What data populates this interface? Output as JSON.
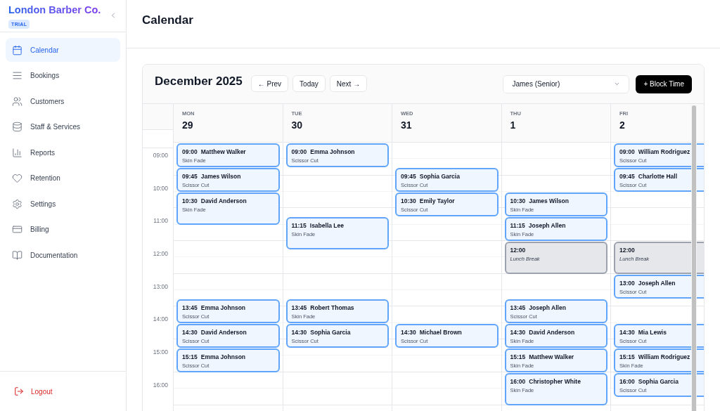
{
  "brand": {
    "name": "London Barber Co.",
    "badge": "TRIAL"
  },
  "sidebar": {
    "items": [
      {
        "label": "Calendar",
        "selected": true
      },
      {
        "label": "Bookings",
        "selected": false
      },
      {
        "label": "Customers",
        "selected": false
      },
      {
        "label": "Staff & Services",
        "selected": false
      },
      {
        "label": "Reports",
        "selected": false
      },
      {
        "label": "Retention",
        "selected": false
      },
      {
        "label": "Settings",
        "selected": false
      },
      {
        "label": "Billing",
        "selected": false
      },
      {
        "label": "Documentation",
        "selected": false
      }
    ],
    "logout": "Logout"
  },
  "page": {
    "title": "Calendar"
  },
  "calendar": {
    "month": "December 2025",
    "prev": "← Prev",
    "today": "Today",
    "next": "Next →",
    "staff_select": "James (Senior)",
    "block_button": "+ Block Time",
    "hours": [
      "09:00",
      "10:00",
      "11:00",
      "12:00",
      "13:00",
      "14:00",
      "15:00",
      "16:00"
    ],
    "days": [
      {
        "weekday": "MON",
        "date": "29",
        "events": [
          {
            "kind": "appointment",
            "time": "09:00",
            "name": "Matthew Walker",
            "service": "Skin Fade",
            "long": false
          },
          {
            "kind": "appointment",
            "time": "09:45",
            "name": "James Wilson",
            "service": "Scissor Cut",
            "long": false
          },
          {
            "kind": "appointment",
            "time": "10:30",
            "name": "David Anderson",
            "service": "Skin Fade",
            "long": true
          },
          {
            "kind": "appointment",
            "time": "13:45",
            "name": "Emma Johnson",
            "service": "Scissor Cut",
            "long": false
          },
          {
            "kind": "appointment",
            "time": "14:30",
            "name": "David Anderson",
            "service": "Scissor Cut",
            "long": false
          },
          {
            "kind": "appointment",
            "time": "15:15",
            "name": "Emma Johnson",
            "service": "Scissor Cut",
            "long": false
          }
        ]
      },
      {
        "weekday": "TUE",
        "date": "30",
        "events": [
          {
            "kind": "appointment",
            "time": "09:00",
            "name": "Emma Johnson",
            "service": "Scissor Cut",
            "long": false
          },
          {
            "kind": "appointment",
            "time": "11:15",
            "name": "Isabella Lee",
            "service": "Skin Fade",
            "long": true
          },
          {
            "kind": "appointment",
            "time": "13:45",
            "name": "Robert Thomas",
            "service": "Skin Fade",
            "long": false
          },
          {
            "kind": "appointment",
            "time": "14:30",
            "name": "Sophia Garcia",
            "service": "Scissor Cut",
            "long": false
          }
        ]
      },
      {
        "weekday": "WED",
        "date": "31",
        "events": [
          {
            "kind": "appointment",
            "time": "09:45",
            "name": "Sophia Garcia",
            "service": "Scissor Cut",
            "long": false
          },
          {
            "kind": "appointment",
            "time": "10:30",
            "name": "Emily Taylor",
            "service": "Scissor Cut",
            "long": false
          },
          {
            "kind": "appointment",
            "time": "14:30",
            "name": "Michael Brown",
            "service": "Scissor Cut",
            "long": false
          }
        ]
      },
      {
        "weekday": "THU",
        "date": "1",
        "events": [
          {
            "kind": "appointment",
            "time": "10:30",
            "name": "James Wilson",
            "service": "Skin Fade",
            "long": false
          },
          {
            "kind": "appointment",
            "time": "11:15",
            "name": "Joseph Allen",
            "service": "Skin Fade",
            "long": false
          },
          {
            "kind": "block",
            "time": "12:00",
            "service": "Lunch Break",
            "long": true
          },
          {
            "kind": "appointment",
            "time": "13:45",
            "name": "Joseph Allen",
            "service": "Scissor Cut",
            "long": false
          },
          {
            "kind": "appointment",
            "time": "14:30",
            "name": "David Anderson",
            "service": "Skin Fade",
            "long": false
          },
          {
            "kind": "appointment",
            "time": "15:15",
            "name": "Matthew Walker",
            "service": "Skin Fade",
            "long": false
          },
          {
            "kind": "appointment",
            "time": "16:00",
            "name": "Christopher White",
            "service": "Skin Fade",
            "long": true
          }
        ]
      },
      {
        "weekday": "FRI",
        "date": "2",
        "events": [
          {
            "kind": "appointment",
            "time": "09:00",
            "name": "William Rodriguez",
            "service": "Scissor Cut",
            "long": false
          },
          {
            "kind": "appointment",
            "time": "09:45",
            "name": "Charlotte Hall",
            "service": "Scissor Cut",
            "long": false
          },
          {
            "kind": "block",
            "time": "12:00",
            "service": "Lunch Break",
            "long": true
          },
          {
            "kind": "appointment",
            "time": "13:00",
            "name": "Joseph Allen",
            "service": "Scissor Cut",
            "long": false
          },
          {
            "kind": "appointment",
            "time": "14:30",
            "name": "Mia Lewis",
            "service": "Scissor Cut",
            "long": false
          },
          {
            "kind": "appointment",
            "time": "15:15",
            "name": "William Rodriguez",
            "service": "Skin Fade",
            "long": false
          },
          {
            "kind": "appointment",
            "time": "16:00",
            "name": "Sophia Garcia",
            "service": "Scissor Cut",
            "long": false
          }
        ]
      }
    ]
  }
}
